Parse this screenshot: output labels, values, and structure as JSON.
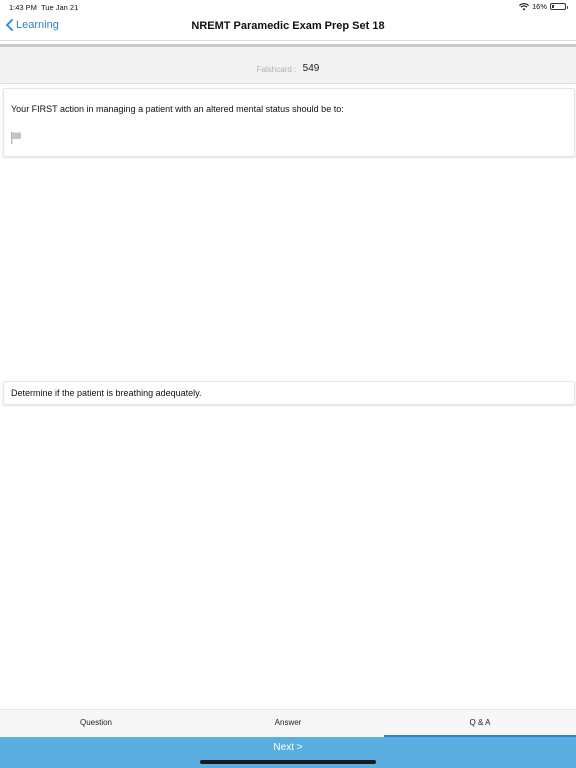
{
  "status": {
    "time": "1:43 PM",
    "date": "Tue Jan 21",
    "battery": "16%",
    "battery_level": 0.16
  },
  "nav": {
    "back_label": "Learning",
    "title": "NREMT Paramedic Exam Prep Set 18"
  },
  "card": {
    "label": "Falshcard :",
    "number": "549"
  },
  "question": {
    "text": "Your FIRST action in managing a patient with an altered mental status should be to:"
  },
  "answer": {
    "text": "Determine if the patient is breathing adequately."
  },
  "tabs": [
    {
      "label": "Question"
    },
    {
      "label": "Answer"
    },
    {
      "label": "Q & A",
      "active": true
    }
  ],
  "footer": {
    "next_label": "Next >"
  },
  "colors": {
    "accent": "#2f7fd4",
    "bottom_bar": "#5aaee0"
  }
}
